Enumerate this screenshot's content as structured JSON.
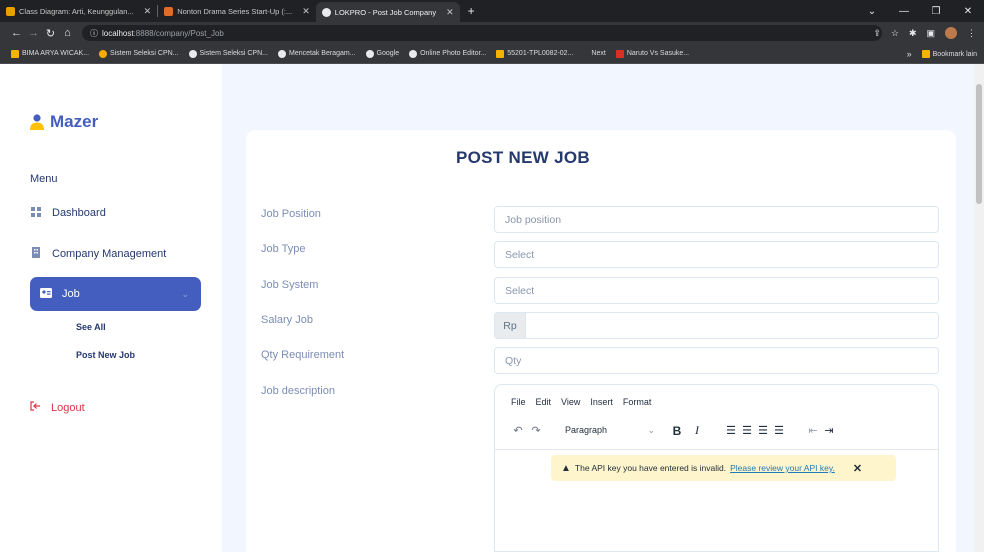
{
  "browser": {
    "tabs": [
      {
        "title": "Class Diagram: Arti, Keunggulan...",
        "close": "✕",
        "color": "#e8a000"
      },
      {
        "title": "Nonton Drama Series Start-Up (:...",
        "close": "✕",
        "color": "#e06b2b"
      },
      {
        "title": "LOKPRO - Post Job Company",
        "close": "✕",
        "color": "#e8eaed"
      }
    ],
    "new_tab": "+",
    "url_host": "localhost",
    "url_path": ":8888/company/Post_Job",
    "bookmarks": [
      {
        "label": "BIMA ARYA WICAK...",
        "color": "#f4b400"
      },
      {
        "label": "Sistem Seleksi CPN...",
        "color": "#f9ab00"
      },
      {
        "label": "Sistem Seleksi CPN...",
        "color": "#e8eaed"
      },
      {
        "label": "Mencetak Beragam...",
        "color": "#e8eaed"
      },
      {
        "label": "Google",
        "color": "#e8eaed"
      },
      {
        "label": "Online Photo Editor...",
        "color": "#e8eaed"
      },
      {
        "label": "55201-TPL0082-02...",
        "color": "#f4b400"
      },
      {
        "label": "Next",
        "color": "#35363a"
      },
      {
        "label": "Naruto Vs Sasuke...",
        "color": "#d93025"
      }
    ],
    "bookmarks_more": "»",
    "bookmarks_other": "Bookmark lain"
  },
  "sidebar": {
    "brand": "Mazer",
    "menu_title": "Menu",
    "items": [
      {
        "label": "Dashboard",
        "icon": "grid-icon"
      },
      {
        "label": "Company Management",
        "icon": "building-icon"
      },
      {
        "label": "Job",
        "icon": "id-card-icon"
      }
    ],
    "sub_items": [
      "See All",
      "Post New Job"
    ],
    "logout": "Logout"
  },
  "form": {
    "title": "POST NEW JOB",
    "fields": [
      {
        "label": "Job Position",
        "placeholder": "Job position"
      },
      {
        "label": "Job Type",
        "placeholder": "Select"
      },
      {
        "label": "Job System",
        "placeholder": "Select"
      },
      {
        "label": "Salary Job",
        "prefix": "Rp",
        "placeholder": ""
      },
      {
        "label": "Qty Requirement",
        "placeholder": "Qty"
      },
      {
        "label": "Job description"
      }
    ],
    "editor": {
      "menus": [
        "File",
        "Edit",
        "View",
        "Insert",
        "Format"
      ],
      "block_format": "Paragraph",
      "notice_text": "The API key you have entered is invalid.",
      "notice_link": "Please review your API key."
    }
  },
  "colors": {
    "primary": "#435ebe",
    "logout": "#dc3545",
    "notice_bg": "#fff5cc"
  }
}
